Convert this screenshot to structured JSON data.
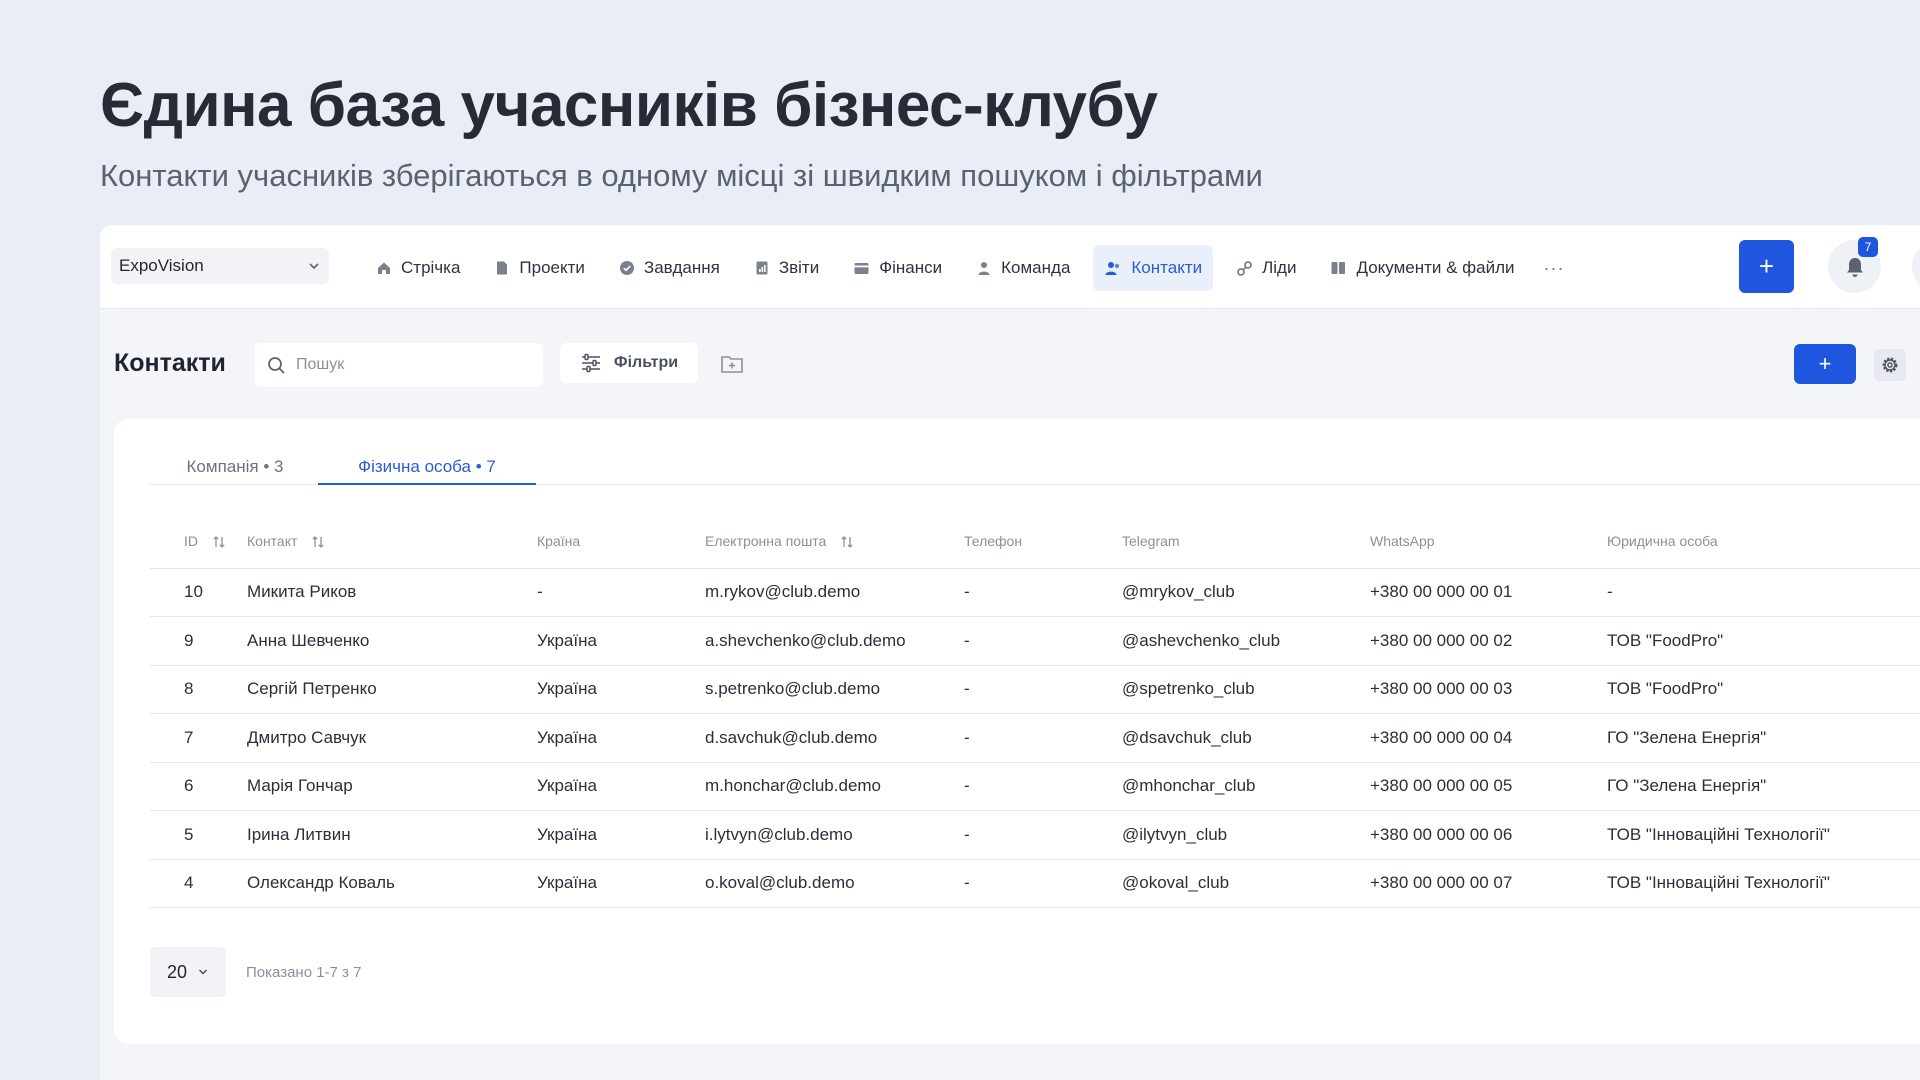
{
  "hero": {
    "title": "Єдина база учасників бізнес-клубу",
    "subtitle": "Контакти учасників зберігаються в одному місці зі швидким пошуком і фільтрами"
  },
  "topbar": {
    "workspace": "ExpoVision",
    "nav": [
      {
        "label": "Стрічка",
        "icon": "home-icon"
      },
      {
        "label": "Проекти",
        "icon": "document-icon"
      },
      {
        "label": "Завдання",
        "icon": "check-circle-icon"
      },
      {
        "label": "Звіти",
        "icon": "report-icon"
      },
      {
        "label": "Фінанси",
        "icon": "wallet-icon"
      },
      {
        "label": "Команда",
        "icon": "person-icon"
      },
      {
        "label": "Контакти",
        "icon": "contacts-icon",
        "active": true
      },
      {
        "label": "Ліди",
        "icon": "link-icon"
      },
      {
        "label": "Документи & файли",
        "icon": "files-icon"
      }
    ],
    "more": "···",
    "add": "+",
    "notifications_count": "7"
  },
  "page": {
    "title": "Контакти",
    "search_placeholder": "Пошук",
    "filters_label": "Фільтри",
    "add": "+"
  },
  "tabs": [
    {
      "label": "Компанія • 3",
      "active": false
    },
    {
      "label": "Фізична особа • 7",
      "active": true
    }
  ],
  "table": {
    "headers": {
      "id": "ID",
      "contact": "Контакт",
      "country": "Країна",
      "email": "Електронна пошта",
      "phone": "Телефон",
      "telegram": "Telegram",
      "whatsapp": "WhatsApp",
      "legal": "Юридична особа"
    },
    "rows": [
      {
        "id": "10",
        "contact": "Микита Риков",
        "country": "-",
        "email": "m.rykov@club.demo",
        "phone": "-",
        "telegram": "@mrykov_club",
        "whatsapp": "+380 00 000 00 01",
        "legal": "-"
      },
      {
        "id": "9",
        "contact": "Анна Шевченко",
        "country": "Україна",
        "email": "a.shevchenko@club.demo",
        "phone": "-",
        "telegram": "@ashevchenko_club",
        "whatsapp": "+380 00 000 00 02",
        "legal": "ТОВ \"FoodPro\""
      },
      {
        "id": "8",
        "contact": "Сергій Петренко",
        "country": "Україна",
        "email": "s.petrenko@club.demo",
        "phone": "-",
        "telegram": "@spetrenko_club",
        "whatsapp": "+380 00 000 00 03",
        "legal": "ТОВ \"FoodPro\""
      },
      {
        "id": "7",
        "contact": "Дмитро Савчук",
        "country": "Україна",
        "email": "d.savchuk@club.demo",
        "phone": "-",
        "telegram": "@dsavchuk_club",
        "whatsapp": "+380 00 000 00 04",
        "legal": "ГО \"Зелена Енергія\""
      },
      {
        "id": "6",
        "contact": "Марія Гончар",
        "country": "Україна",
        "email": "m.honchar@club.demo",
        "phone": "-",
        "telegram": "@mhonchar_club",
        "whatsapp": "+380 00 000 00 05",
        "legal": "ГО \"Зелена Енергія\""
      },
      {
        "id": "5",
        "contact": "Ірина Литвин",
        "country": "Україна",
        "email": "i.lytvyn@club.demo",
        "phone": "-",
        "telegram": "@ilytvyn_club",
        "whatsapp": "+380 00 000 00 06",
        "legal": "ТОВ \"Інноваційні Технології\""
      },
      {
        "id": "4",
        "contact": "Олександр Коваль",
        "country": "Україна",
        "email": "o.koval@club.demo",
        "phone": "-",
        "telegram": "@okoval_club",
        "whatsapp": "+380 00 000 00 07",
        "legal": "ТОВ \"Інноваційні Технології\""
      }
    ]
  },
  "pagination": {
    "page_size": "20",
    "shown": "Показано 1-7 з 7"
  },
  "colors": {
    "accent": "#1f56e0",
    "active_nav_bg": "#eaf0fb",
    "background": "#e9eef6"
  }
}
